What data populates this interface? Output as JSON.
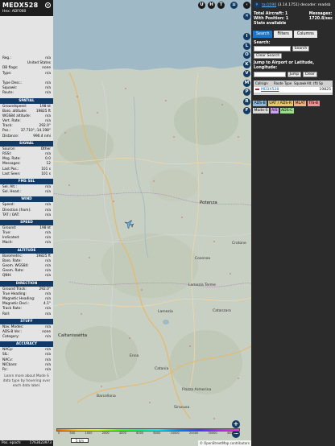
{
  "aircraft": {
    "callsign": "MEDX528",
    "hex_label": "Hex:",
    "hex": "ADF060"
  },
  "info_rows_top": [
    {
      "k": "Reg.:",
      "v": "n/a"
    },
    {
      "k": "",
      "v": "United States"
    },
    {
      "k": "DB flags:",
      "v": "none"
    },
    {
      "k": "Type:",
      "v": "n/a"
    },
    {
      "k": "",
      "v": ""
    },
    {
      "k": "Type Desc.:",
      "v": "n/a"
    },
    {
      "k": "Squawk:",
      "v": "n/a"
    },
    {
      "k": "Route:",
      "v": "n/a"
    }
  ],
  "sections": {
    "spatial": "SPATIAL",
    "signal": "SIGNAL",
    "fms": "FMS SEL",
    "wind": "WIND",
    "speed": "SPEED",
    "altitude": "ALTITUDE",
    "direction": "DIRECTION",
    "stuff": "STUFF",
    "accuracy": "ACCURACY"
  },
  "spatial": [
    {
      "k": "Groundspeed:",
      "v": "198 kt"
    },
    {
      "k": "Baro. altitude:",
      "v": "19825 ft"
    },
    {
      "k": "WGS84 altitude:",
      "v": "n/a"
    },
    {
      "k": "Vert. Rate:",
      "v": "n/a"
    },
    {
      "k": "Track:",
      "v": "292.0°"
    },
    {
      "k": "Pos.:",
      "v": "37.710°,-14.198°"
    },
    {
      "k": "Distance:",
      "v": "990.4 nmi"
    }
  ],
  "signal": [
    {
      "k": "Source:",
      "v": "Other"
    },
    {
      "k": "RSSI:",
      "v": "n/a"
    },
    {
      "k": "Msg. Rate:",
      "v": "0.0"
    },
    {
      "k": "Messages:",
      "v": "12"
    },
    {
      "k": "Last Pos.:",
      "v": "101 s"
    },
    {
      "k": "Last Seen:",
      "v": "101 s"
    }
  ],
  "fms": [
    {
      "k": "Sel. Alt.:",
      "v": "n/a"
    },
    {
      "k": "Sel. Head.:",
      "v": "n/a"
    }
  ],
  "wind": [
    {
      "k": "Speed:",
      "v": "n/a"
    },
    {
      "k": "Direction (from):",
      "v": "n/a"
    },
    {
      "k": "TAT / OAT:",
      "v": "n/a"
    }
  ],
  "speed": [
    {
      "k": "Ground:",
      "v": "198 kt"
    },
    {
      "k": "True:",
      "v": "n/a"
    },
    {
      "k": "Indicated:",
      "v": "n/a"
    },
    {
      "k": "Mach:",
      "v": "n/a"
    }
  ],
  "altitude": [
    {
      "k": "Barometric:",
      "v": "19825 ft"
    },
    {
      "k": "Baro. Rate:",
      "v": "n/a"
    },
    {
      "k": "Geom. WGS84:",
      "v": "n/a"
    },
    {
      "k": "Geom. Rate:",
      "v": "n/a"
    },
    {
      "k": "QNH:",
      "v": "n/a"
    }
  ],
  "direction": [
    {
      "k": "Ground Track:",
      "v": "292.0°"
    },
    {
      "k": "True Heading:",
      "v": "n/a"
    },
    {
      "k": "Magnetic Heading:",
      "v": "n/a"
    },
    {
      "k": "Magnetic Decl.:",
      "v": "4.1°"
    },
    {
      "k": "Track Rate:",
      "v": "n/a"
    },
    {
      "k": "Roll:",
      "v": "n/a"
    }
  ],
  "stuff": [
    {
      "k": "Nav. Modes:",
      "v": "n/a"
    },
    {
      "k": "ADS-B Ver.:",
      "v": "none"
    },
    {
      "k": "Category:",
      "v": "n/a"
    }
  ],
  "accuracy": [
    {
      "k": "NACp:",
      "v": "n/a"
    },
    {
      "k": "SIL:",
      "v": "n/a"
    },
    {
      "k": "NACv:",
      "v": "n/a"
    },
    {
      "k": "NICbaro:",
      "v": "n/a"
    },
    {
      "k": "Rc:",
      "v": "n/a"
    }
  ],
  "note": "Learn more about Mode S data type by hovering over each data label.",
  "footer": {
    "k": "Pos. epoch:",
    "v": "1763623973"
  },
  "map": {
    "top_buttons": [
      "U",
      "H",
      "T"
    ],
    "places": [
      "Potenza",
      "Cosenza",
      "Lamezia Terme",
      "Catanzaro",
      "Crotone",
      "Caltanissetta",
      "Catania",
      "Siracusa",
      "Barcellona",
      "Piazza Armerina",
      "Enna",
      "Lamezia"
    ],
    "legend_ticks": [
      "0",
      "500",
      "1000",
      "2000",
      "4000",
      "6000",
      "8000",
      "10000",
      "20000",
      "30000",
      "40000+"
    ],
    "scale": "5 km",
    "attribution": "© OpenStreetMap contributors",
    "zoom_in": "+",
    "zoom_out": "−"
  },
  "tools": [
    "I",
    "L",
    "O",
    "K",
    "V",
    "M",
    "P",
    "R",
    "F"
  ],
  "side": {
    "version_prefix": "tar1090",
    "version": "(3.14.1751)",
    "decoder": "decoder: readsb",
    "total_aircraft": "Total Aircraft: 1",
    "messages_label": "Messages:",
    "messages_value": "1720.8/sec",
    "with_position": "With Position: 1",
    "stats": "Stats available",
    "tabs": [
      "Search",
      "Filters",
      "Columns"
    ],
    "search_label": "Search:",
    "search_btn": "Search",
    "clear_search": "Clear Search",
    "jump_label": "Jump to Airport or Latitude, Longitude:",
    "jump_btn": "Jump",
    "clear_btn": "Clear",
    "columns": [
      "Callsign",
      "Route",
      "Type",
      "Squawk",
      "Alt. (ft)",
      "Sp"
    ],
    "row": {
      "callsign": "MEDX528",
      "alt": "19825"
    },
    "legend": [
      {
        "label": "ADS-B",
        "color": "#89b8e0"
      },
      {
        "label": "UAT / ADS-R",
        "color": "#e8c766"
      },
      {
        "label": "MLAT",
        "color": "#f2b07a"
      },
      {
        "label": "TIS-B",
        "color": "#f28f8f"
      },
      {
        "label": "Mode-S",
        "color": "#d9d9d9"
      },
      {
        "label": "AIS",
        "color": "#c9a4e8"
      },
      {
        "label": "ADS-C",
        "color": "#9ddc8c"
      }
    ]
  }
}
